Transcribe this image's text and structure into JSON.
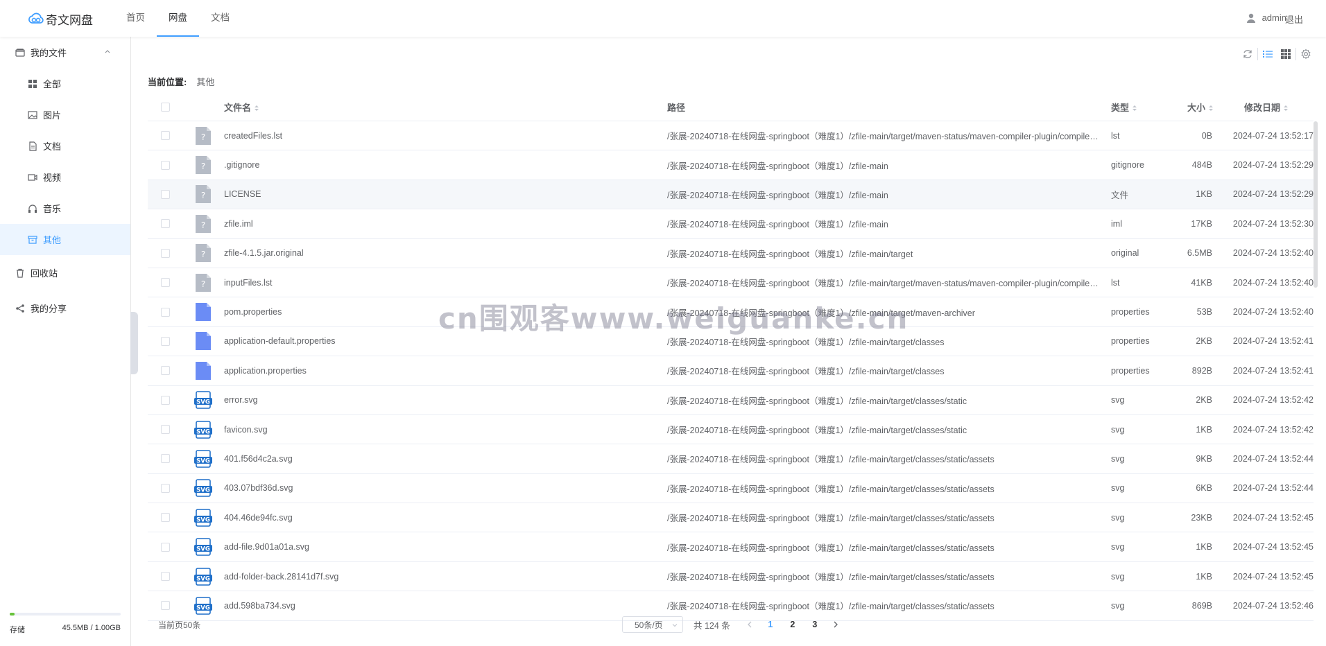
{
  "app": {
    "logo_text": "奇文网盘"
  },
  "nav": [
    {
      "label": "首页",
      "active": false
    },
    {
      "label": "网盘",
      "active": true
    },
    {
      "label": "文档",
      "active": false
    }
  ],
  "user": {
    "name": "admin",
    "logout": "退出"
  },
  "sidebar": {
    "my_files": "我的文件",
    "items": [
      {
        "label": "全部",
        "icon": "grid-icon"
      },
      {
        "label": "图片",
        "icon": "image-icon"
      },
      {
        "label": "文档",
        "icon": "document-icon"
      },
      {
        "label": "视频",
        "icon": "video-icon"
      },
      {
        "label": "音乐",
        "icon": "headphones-icon"
      },
      {
        "label": "其他",
        "icon": "box-icon",
        "active": true
      }
    ],
    "recycle": "回收站",
    "share": "我的分享",
    "storage": {
      "label": "存储",
      "value": "45.5MB / 1.00GB",
      "fraction": 0.044
    }
  },
  "breadcrumb": {
    "label": "当前位置:",
    "current": "其他"
  },
  "table": {
    "headers": {
      "name": "文件名",
      "path": "路径",
      "type": "类型",
      "size": "大小",
      "date": "修改日期"
    },
    "rows": [
      {
        "icon": "unknown",
        "name": "createdFiles.lst",
        "path": "/张展-20240718-在线网盘-springboot（难度1）/zfile-main/target/maven-status/maven-compiler-plugin/compile/default-compile",
        "type": "lst",
        "size": "0B",
        "date": "2024-07-24 13:52:17"
      },
      {
        "icon": "unknown",
        "name": ".gitignore",
        "path": "/张展-20240718-在线网盘-springboot（难度1）/zfile-main",
        "type": "gitignore",
        "size": "484B",
        "date": "2024-07-24 13:52:29"
      },
      {
        "icon": "unknown",
        "name": "LICENSE",
        "path": "/张展-20240718-在线网盘-springboot（难度1）/zfile-main",
        "type": "文件",
        "size": "1KB",
        "date": "2024-07-24 13:52:29"
      },
      {
        "icon": "unknown",
        "name": "zfile.iml",
        "path": "/张展-20240718-在线网盘-springboot（难度1）/zfile-main",
        "type": "iml",
        "size": "17KB",
        "date": "2024-07-24 13:52:30"
      },
      {
        "icon": "unknown",
        "name": "zfile-4.1.5.jar.original",
        "path": "/张展-20240718-在线网盘-springboot（难度1）/zfile-main/target",
        "type": "original",
        "size": "6.5MB",
        "date": "2024-07-24 13:52:40"
      },
      {
        "icon": "unknown",
        "name": "inputFiles.lst",
        "path": "/张展-20240718-在线网盘-springboot（难度1）/zfile-main/target/maven-status/maven-compiler-plugin/compile/default-compile",
        "type": "lst",
        "size": "41KB",
        "date": "2024-07-24 13:52:40"
      },
      {
        "icon": "properties",
        "name": "pom.properties",
        "path": "/张展-20240718-在线网盘-springboot（难度1）/zfile-main/target/maven-archiver",
        "type": "properties",
        "size": "53B",
        "date": "2024-07-24 13:52:40"
      },
      {
        "icon": "properties",
        "name": "application-default.properties",
        "path": "/张展-20240718-在线网盘-springboot（难度1）/zfile-main/target/classes",
        "type": "properties",
        "size": "2KB",
        "date": "2024-07-24 13:52:41"
      },
      {
        "icon": "properties",
        "name": "application.properties",
        "path": "/张展-20240718-在线网盘-springboot（难度1）/zfile-main/target/classes",
        "type": "properties",
        "size": "892B",
        "date": "2024-07-24 13:52:41"
      },
      {
        "icon": "svg",
        "name": "error.svg",
        "path": "/张展-20240718-在线网盘-springboot（难度1）/zfile-main/target/classes/static",
        "type": "svg",
        "size": "2KB",
        "date": "2024-07-24 13:52:42"
      },
      {
        "icon": "svg",
        "name": "favicon.svg",
        "path": "/张展-20240718-在线网盘-springboot（难度1）/zfile-main/target/classes/static",
        "type": "svg",
        "size": "1KB",
        "date": "2024-07-24 13:52:42"
      },
      {
        "icon": "svg",
        "name": "401.f56d4c2a.svg",
        "path": "/张展-20240718-在线网盘-springboot（难度1）/zfile-main/target/classes/static/assets",
        "type": "svg",
        "size": "9KB",
        "date": "2024-07-24 13:52:44"
      },
      {
        "icon": "svg",
        "name": "403.07bdf36d.svg",
        "path": "/张展-20240718-在线网盘-springboot（难度1）/zfile-main/target/classes/static/assets",
        "type": "svg",
        "size": "6KB",
        "date": "2024-07-24 13:52:44"
      },
      {
        "icon": "svg",
        "name": "404.46de94fc.svg",
        "path": "/张展-20240718-在线网盘-springboot（难度1）/zfile-main/target/classes/static/assets",
        "type": "svg",
        "size": "23KB",
        "date": "2024-07-24 13:52:45"
      },
      {
        "icon": "svg",
        "name": "add-file.9d01a01a.svg",
        "path": "/张展-20240718-在线网盘-springboot（难度1）/zfile-main/target/classes/static/assets",
        "type": "svg",
        "size": "1KB",
        "date": "2024-07-24 13:52:45"
      },
      {
        "icon": "svg",
        "name": "add-folder-back.28141d7f.svg",
        "path": "/张展-20240718-在线网盘-springboot（难度1）/zfile-main/target/classes/static/assets",
        "type": "svg",
        "size": "1KB",
        "date": "2024-07-24 13:52:45"
      },
      {
        "icon": "svg",
        "name": "add.598ba734.svg",
        "path": "/张展-20240718-在线网盘-springboot（难度1）/zfile-main/target/classes/static/assets",
        "type": "svg",
        "size": "869B",
        "date": "2024-07-24 13:52:46"
      }
    ]
  },
  "pager": {
    "current_page_info": "当前页50条",
    "page_size": "50条/页",
    "total": "共 124 条",
    "pages": [
      "1",
      "2",
      "3"
    ],
    "active_page": "1"
  },
  "watermark": "cn围观客www.weiguanke.cn",
  "colors": {
    "accent": "#409eff",
    "active_bg": "#ecf5ff",
    "storage_fill": "#67c23a"
  }
}
